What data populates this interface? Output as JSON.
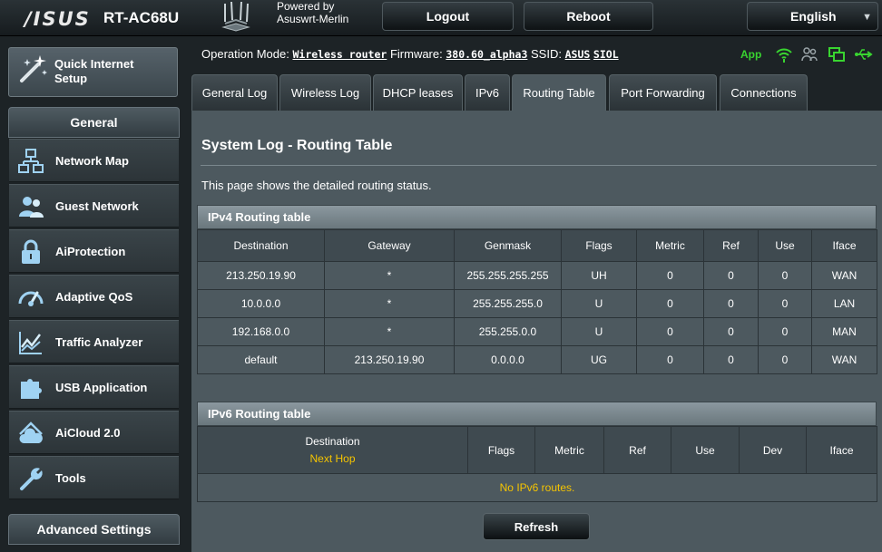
{
  "header": {
    "brand": "/ISUS",
    "model": "RT-AC68U",
    "powered_by_line1": "Powered by",
    "powered_by_line2": "Asuswrt-Merlin",
    "logout_label": "Logout",
    "reboot_label": "Reboot",
    "language": "English"
  },
  "sidebar": {
    "quick_setup_label": "Quick Internet Setup",
    "general_heading": "General",
    "advanced_heading": "Advanced Settings",
    "items": [
      {
        "label": "Network Map",
        "icon": "network-map-icon"
      },
      {
        "label": "Guest Network",
        "icon": "guest-network-icon"
      },
      {
        "label": "AiProtection",
        "icon": "lock-icon"
      },
      {
        "label": "Adaptive QoS",
        "icon": "speedometer-icon"
      },
      {
        "label": "Traffic Analyzer",
        "icon": "traffic-chart-icon"
      },
      {
        "label": "USB Application",
        "icon": "puzzle-icon"
      },
      {
        "label": "AiCloud 2.0",
        "icon": "cloud-home-icon"
      },
      {
        "label": "Tools",
        "icon": "wrench-icon"
      }
    ]
  },
  "status_bar": {
    "op_mode_label": "Operation Mode:",
    "op_mode_value": "Wireless router",
    "firmware_label": "Firmware:",
    "firmware_value": "380.60_alpha3",
    "ssid_label": "SSID:",
    "ssid_1": "ASUS",
    "ssid_2": "SIOL",
    "app_label": "App",
    "accent_color": "#39d430"
  },
  "tabs": [
    {
      "label": "General Log"
    },
    {
      "label": "Wireless Log"
    },
    {
      "label": "DHCP leases"
    },
    {
      "label": "IPv6"
    },
    {
      "label": "Routing Table"
    },
    {
      "label": "Port Forwarding"
    },
    {
      "label": "Connections"
    }
  ],
  "active_tab": "Routing Table",
  "page": {
    "title": "System Log - Routing Table",
    "description": "This page shows the detailed routing status."
  },
  "ipv4": {
    "caption": "IPv4 Routing table",
    "headers": [
      "Destination",
      "Gateway",
      "Genmask",
      "Flags",
      "Metric",
      "Ref",
      "Use",
      "Iface"
    ],
    "rows": [
      [
        "213.250.19.90",
        "*",
        "255.255.255.255",
        "UH",
        "0",
        "0",
        "0",
        "WAN"
      ],
      [
        "10.0.0.0",
        "*",
        "255.255.255.0",
        "U",
        "0",
        "0",
        "0",
        "LAN"
      ],
      [
        "192.168.0.0",
        "*",
        "255.255.0.0",
        "U",
        "0",
        "0",
        "0",
        "MAN"
      ],
      [
        "default",
        "213.250.19.90",
        "0.0.0.0",
        "UG",
        "0",
        "0",
        "0",
        "WAN"
      ]
    ]
  },
  "ipv6": {
    "caption": "IPv6 Routing table",
    "headers": {
      "destination": "Destination",
      "next_hop": "Next Hop",
      "flags": "Flags",
      "metric": "Metric",
      "ref": "Ref",
      "use": "Use",
      "dev": "Dev",
      "iface": "Iface"
    },
    "empty_message": "No IPv6 routes."
  },
  "refresh_label": "Refresh"
}
